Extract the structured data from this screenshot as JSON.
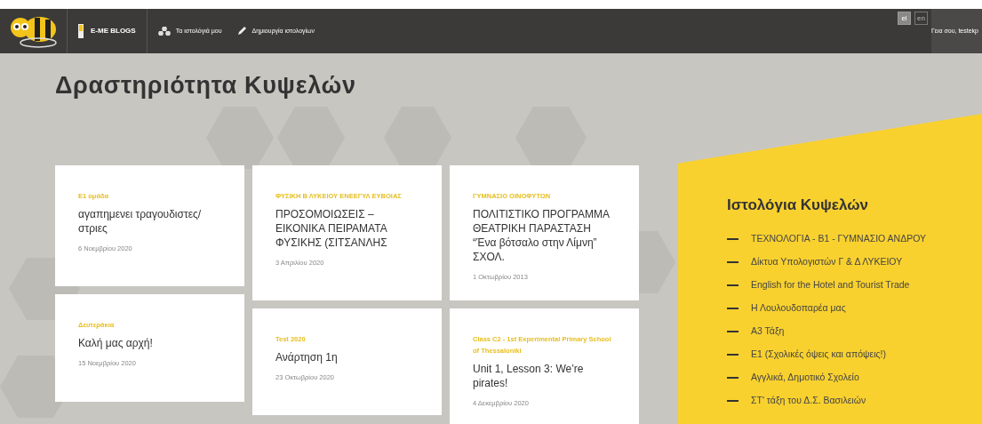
{
  "navbar": {
    "brand": "E-ME BLOGS",
    "links": [
      {
        "label": "Τα ιστολόγιά μου"
      },
      {
        "label": "Δημιουργία ιστολογίων"
      }
    ],
    "languages": [
      {
        "label": "el",
        "selected": true
      },
      {
        "label": "en",
        "selected": false
      }
    ],
    "greeting": "Γεια σου, testekp"
  },
  "page_title": "Δραστηριότητα Κυψελών",
  "card_columns": [
    [
      {
        "hive": "Ε1 ομάδα",
        "title": "αγαπημενει τραγουδιστες/στριες",
        "date": "6 Νοεμβρίου 2020"
      },
      {
        "hive": "Δευτεράκια",
        "title": "Καλή μας αρχή!",
        "date": "15 Νοεμβρίου 2020"
      }
    ],
    [
      {
        "hive": "ΦΥΣΙΚΗ Β ΛΥΚΕΙΟΥ ΕΝΕΕΓΥΛ ΕΥΒΟΙΑΣ",
        "title": "ΠΡΟΣΟΜΟΙΩΣΕΙΣ – ΕΙΚΟΝΙΚΑ ΠΕΙΡΑΜΑΤΑ ΦΥΣΙΚΗΣ (ΣΙΤΣΑΝΛΗΣ",
        "date": "3 Απριλίου 2020"
      },
      {
        "hive": "Test 2020",
        "title": "Ανάρτηση 1η",
        "date": "23 Οκτωβρίου 2020"
      }
    ],
    [
      {
        "hive": "ΓΥΜΝΑΣΙΟ ΟΙΝΟΦΥΤΩΝ",
        "title": "ΠΟΛΙΤΙΣΤΙΚΟ ΠΡΟΓΡΑΜΜΑ ΘΕΑΤΡΙΚΗ ΠΑΡΑΣΤΑΣΗ “Ένα βότσαλο στην Λίμνη” ΣΧΟΛ.",
        "date": "1 Οκτωβρίου 2013"
      },
      {
        "hive": "Class C2 - 1st Experimental Primary School of Thessaloniki",
        "title": "Unit 1, Lesson 3: We’re pirates!",
        "date": "4 Δεκεμβρίου 2020"
      }
    ]
  ],
  "hive_blogs": {
    "title": "Ιστολόγια Κυψελών",
    "items": [
      "ΤΕΧΝΟΛΟΓΙΑ - Β1 - ΓΥΜΝΑΣΙΟ ΑΝΔΡΟΥ",
      "Δίκτυα Υπολογιστών Γ & Δ ΛΥΚΕΙΟΥ",
      "English for the Hotel and Tourist Trade",
      "Η Λουλουδοπαρέα μας",
      "Α3 Τάξη",
      "Ε1 (Σχολικές όψεις και απόψεις!)",
      "Αγγλικά, Δημοτικό Σχολείο",
      "ΣΤ' τάξη του Δ.Σ. Βασιλειών"
    ]
  }
}
